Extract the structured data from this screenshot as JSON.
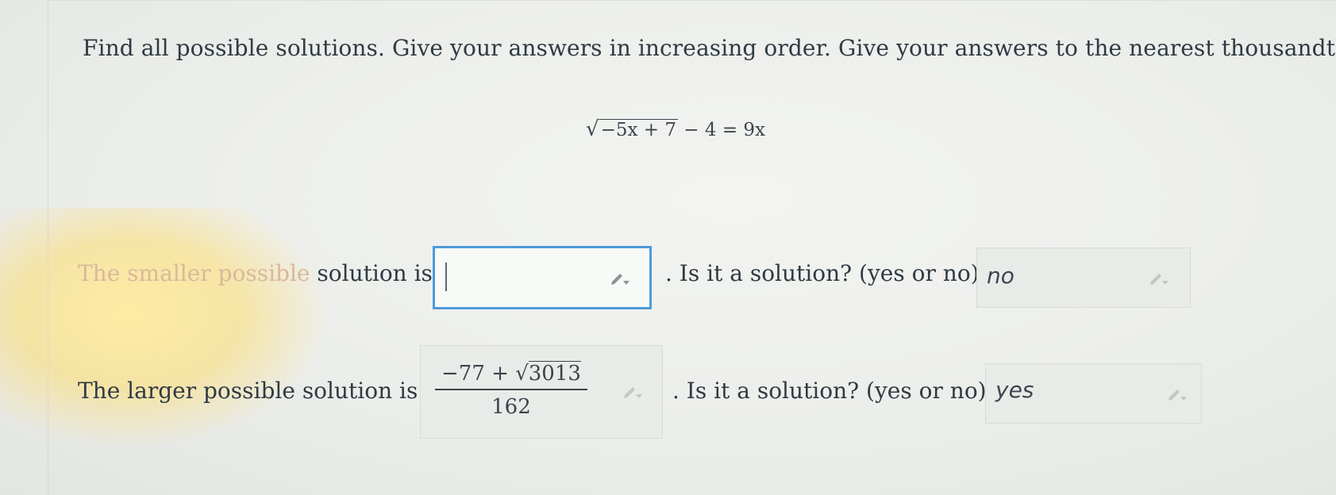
{
  "instructions": "Find all possible solutions. Give your answers in increasing order. Give your answers to the nearest thousandth.",
  "equation": {
    "radical_symbol": "√",
    "radicand": "−5x + 7",
    "rest": "− 4 = 9x"
  },
  "row1": {
    "label_faded": "The smaller possible",
    "label_rest": "solution is",
    "input_value": "",
    "question": ". Is it a solution? (yes or no)",
    "answer": "no"
  },
  "row2": {
    "label": "The larger possible solution is",
    "fraction": {
      "num_prefix": "−77 + ",
      "radical_symbol": "√",
      "radicand": "3013",
      "denominator": "162"
    },
    "question": ". Is it a solution? (yes or no)",
    "answer": "yes"
  },
  "icons": {
    "edit": "pencil-dropdown-icon"
  },
  "colors": {
    "active_border": "#4d9bd9",
    "box_bg": "#e9ebe8",
    "text": "#2f3a42"
  }
}
